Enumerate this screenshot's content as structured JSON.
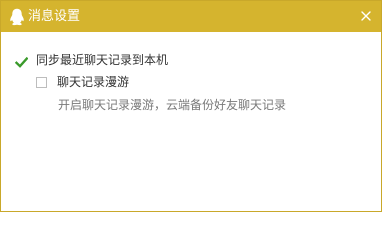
{
  "window": {
    "title": "消息设置",
    "accent_color": "#d5b42e",
    "app_icon": "qq-penguin-icon",
    "close_icon": "close-icon"
  },
  "settings": {
    "sync_recent": {
      "label": "同步最近聊天记录到本机",
      "checked": true,
      "check_color": "#3a9a2b"
    },
    "chat_roaming": {
      "label": "聊天记录漫游",
      "checked": false,
      "hint": "开启聊天记录漫游，云端备份好友聊天记录"
    }
  }
}
